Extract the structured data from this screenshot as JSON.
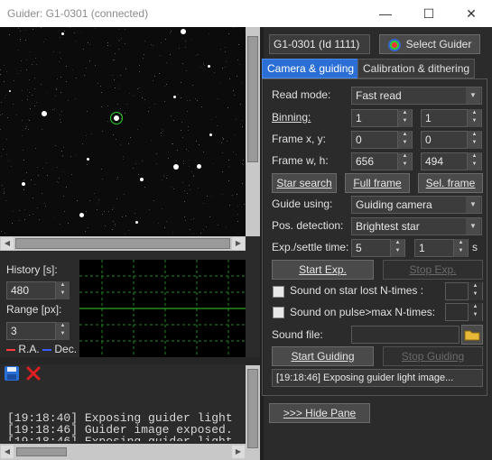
{
  "window": {
    "title": "Guider: G1-0301 (connected)",
    "minimize_glyph": "—",
    "maximize_glyph": "☐",
    "close_glyph": "✕"
  },
  "guider": {
    "device_field": "G1-0301 (Id 1111)",
    "select_guider_label": "Select Guider"
  },
  "tabs": [
    {
      "label": "Camera & guiding",
      "active": true
    },
    {
      "label": "Calibration & dithering",
      "active": false
    }
  ],
  "form": {
    "read_mode_label": "Read mode:",
    "read_mode_value": "Fast read",
    "binning_label": "Binning:",
    "binning_x": "1",
    "binning_y": "1",
    "frame_xy_label": "Frame x, y:",
    "frame_x": "0",
    "frame_y": "0",
    "frame_wh_label": "Frame w, h:",
    "frame_w": "656",
    "frame_h": "494",
    "star_search_label": "Star search",
    "full_frame_label": "Full frame",
    "sel_frame_label": "Sel. frame",
    "guide_using_label": "Guide using:",
    "guide_using_value": "Guiding camera",
    "pos_detection_label": "Pos. detection:",
    "pos_detection_value": "Brightest star",
    "exp_settle_label": "Exp./settle time:",
    "exp_time": "5",
    "settle_time": "1",
    "settle_unit": "s",
    "start_exp_label": "Start Exp.",
    "stop_exp_label": "Stop Exp.",
    "sound_star_lost_label": "Sound on star lost N-times :",
    "sound_star_lost_value": "",
    "sound_pulse_label": "Sound on pulse>max N-times:",
    "sound_pulse_value": "",
    "sound_file_label": "Sound file:",
    "sound_file_value": "",
    "start_guiding_label": "Start Guiding",
    "stop_guiding_label": "Stop Guiding",
    "status_text": "[19:18:46] Exposing guider light image...",
    "hide_pane_label": ">>> Hide Pane"
  },
  "graph": {
    "history_label": "History [s]:",
    "history_value": "480",
    "range_label": "Range [px]:",
    "range_value": "3",
    "legend_ra": "R.A.",
    "legend_dec": "Dec.",
    "ra_color": "#ff3b3b",
    "dec_color": "#3a5cff"
  },
  "log": {
    "lines": [
      "[19:18:40] Exposing guider light",
      "[19:18:46] Guider image exposed.",
      "[19:18:46] Exposing guider light"
    ]
  }
}
